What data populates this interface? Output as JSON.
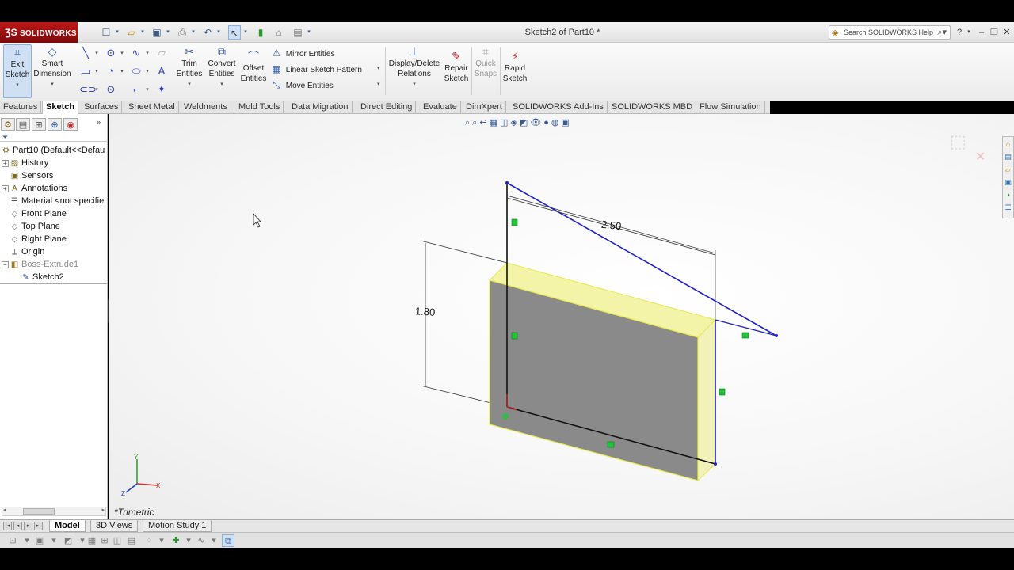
{
  "window": {
    "logo_text": "SOLIDWORKS",
    "document_title": "Sketch2 of Part10 *",
    "search_placeholder": "Search SOLIDWORKS Help"
  },
  "command_manager": {
    "exit_sketch": "Exit Sketch",
    "smart_dimension": "Smart Dimension",
    "trim_entities": "Trim Entities",
    "convert_entities": "Convert Entities",
    "offset_entities": "Offset Entities",
    "mirror_entities": "Mirror Entities",
    "linear_sketch_pattern": "Linear Sketch Pattern",
    "move_entities": "Move Entities",
    "display_delete_relations": "Display/Delete Relations",
    "repair_sketch": "Repair Sketch",
    "quick_snaps": "Quick Snaps",
    "rapid_sketch": "Rapid Sketch"
  },
  "tabs": [
    "Features",
    "Sketch",
    "Surfaces",
    "Sheet Metal",
    "Weldments",
    "Mold Tools",
    "Data Migration",
    "Direct Editing",
    "Evaluate",
    "DimXpert",
    "SOLIDWORKS Add-Ins",
    "SOLIDWORKS MBD",
    "Flow Simulation"
  ],
  "active_tab": "Sketch",
  "feature_tree": {
    "root": "Part10  (Default<<Defau",
    "items": [
      {
        "label": "History",
        "icon": "history-icon"
      },
      {
        "label": "Sensors",
        "icon": "sensors-icon"
      },
      {
        "label": "Annotations",
        "icon": "annotations-icon"
      },
      {
        "label": "Material <not specifie",
        "icon": "material-icon"
      },
      {
        "label": "Front Plane",
        "icon": "plane-icon"
      },
      {
        "label": "Top Plane",
        "icon": "plane-icon"
      },
      {
        "label": "Right Plane",
        "icon": "plane-icon"
      },
      {
        "label": "Origin",
        "icon": "origin-icon"
      },
      {
        "label": "Boss-Extrude1",
        "icon": "extrude-icon"
      },
      {
        "label": "Sketch2",
        "icon": "sketch-icon"
      }
    ]
  },
  "graphics": {
    "view_orientation": "*Trimetric",
    "dimension_length": "2.50",
    "dimension_height": "1.80"
  },
  "bottom_tabs": [
    "Model",
    "3D Views",
    "Motion Study 1"
  ],
  "active_bottom_tab": "Model",
  "colors": {
    "sketch_line": "#2020c8",
    "face_highlight": "#f2f2a0",
    "relation_marker": "#22c43a",
    "logo_red": "#b01212"
  }
}
